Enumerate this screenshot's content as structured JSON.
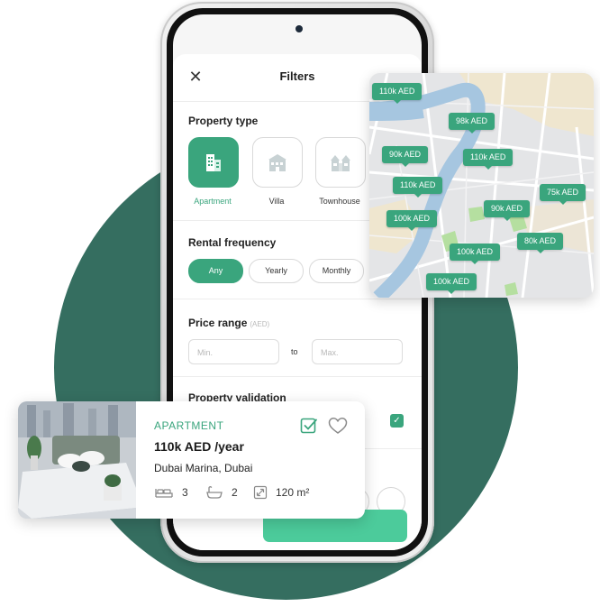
{
  "filters": {
    "title": "Filters",
    "close_icon": "close-icon",
    "property_type": {
      "title": "Property type",
      "options": [
        {
          "label": "Apartment",
          "icon": "apartment-building-icon",
          "selected": true
        },
        {
          "label": "Villa",
          "icon": "villa-icon",
          "selected": false
        },
        {
          "label": "Townhouse",
          "icon": "townhouse-icon",
          "selected": false
        }
      ]
    },
    "rental_frequency": {
      "title": "Rental frequency",
      "options": [
        {
          "label": "Any",
          "selected": true
        },
        {
          "label": "Yearly",
          "selected": false
        },
        {
          "label": "Monthly",
          "selected": false
        }
      ]
    },
    "price_range": {
      "title": "Price range",
      "unit": "(AED)",
      "min_placeholder": "Min.",
      "max_placeholder": "Max.",
      "to_label": "to"
    },
    "property_validation": {
      "title": "Property validation",
      "checked": true
    }
  },
  "map": {
    "markers": [
      "110k AED",
      "98k AED",
      "90k AED",
      "110k AED",
      "110k AED",
      "75k AED",
      "90k AED",
      "100k AED",
      "100k AED",
      "80k AED",
      "100k AED"
    ]
  },
  "listing": {
    "type": "APARTMENT",
    "price": "110k AED /year",
    "location": "Dubai Marina, Dubai",
    "bedrooms": "3",
    "bathrooms": "2",
    "area": "120 m²"
  },
  "colors": {
    "accent": "#3aa57d",
    "accent_light": "#4ccb9b",
    "background_circle": "#356e60"
  }
}
